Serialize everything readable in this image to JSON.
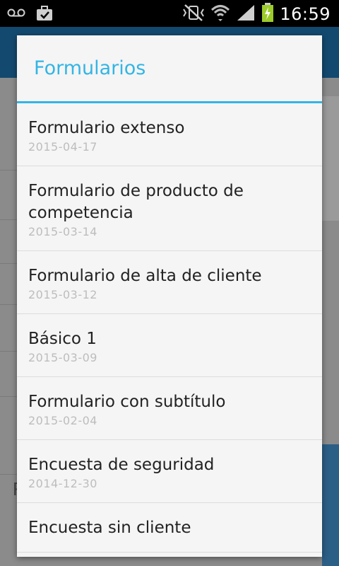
{
  "status_bar": {
    "time": "16:59",
    "icons": [
      "voicemail-icon",
      "briefcase-icon",
      "vibrate-off-icon",
      "wifi-icon",
      "signal-icon",
      "battery-charging-icon"
    ]
  },
  "dialog": {
    "title": "Formularios",
    "items": [
      {
        "title": "Formulario extenso",
        "date": "2015-04-17"
      },
      {
        "title": "Formulario de producto de competencia",
        "date": "2015-03-14"
      },
      {
        "title": "Formulario de alta de cliente",
        "date": "2015-03-12"
      },
      {
        "title": "Básico 1",
        "date": "2015-03-09"
      },
      {
        "title": "Formulario con subtítulo",
        "date": "2015-02-04"
      },
      {
        "title": "Encuesta de seguridad",
        "date": "2014-12-30"
      },
      {
        "title": "Encuesta sin cliente",
        "date": ""
      }
    ]
  },
  "colors": {
    "accent": "#33b5e5",
    "app_bar": "#14496f",
    "dialog_bg": "#f5f5f5",
    "date_text": "#bdbdbd"
  }
}
